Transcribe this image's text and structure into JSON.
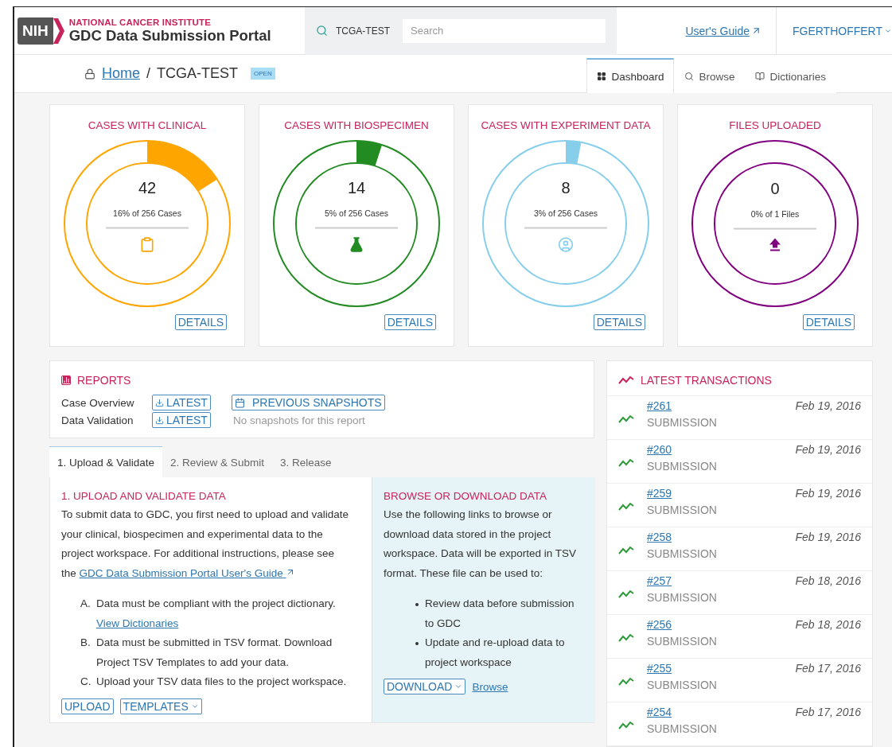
{
  "header": {
    "logo_mark": "NIH",
    "institute": "NATIONAL CANCER INSTITUTE",
    "portal_title": "GDC Data Submission Portal",
    "project": "TCGA-TEST",
    "search": {
      "placeholder": "Search"
    },
    "guide_link": "User's Guide",
    "user": "FGERTHOFFERT"
  },
  "breadcrumb": {
    "home": "Home",
    "separator": "/",
    "project": "TCGA-TEST",
    "badge": "OPEN"
  },
  "nav_tabs": [
    {
      "label": "Dashboard",
      "kind": "dashboard",
      "selected": true
    },
    {
      "label": "Browse",
      "kind": "browse",
      "selected": false
    },
    {
      "label": "Dictionaries",
      "kind": "dictionaries",
      "selected": false
    }
  ],
  "cards": [
    {
      "title": "CASES WITH CLINICAL",
      "kind": "clinical",
      "color": "#ffa500",
      "count": "42",
      "caption": "16% of 256 Cases",
      "level": 0.16,
      "button": "DETAILS"
    },
    {
      "title": "CASES WITH BIOSPECIMEN",
      "kind": "biospecimen",
      "color": "#228b22",
      "count": "14",
      "caption": "5% of 256 Cases",
      "level": 0.05,
      "button": "DETAILS"
    },
    {
      "title": "CASES WITH EXPERIMENT DATA",
      "kind": "experiment",
      "color": "#87ceeb",
      "count": "8",
      "caption": "3% of 256 Cases",
      "level": 0.03,
      "button": "DETAILS"
    },
    {
      "title": "FILES UPLOADED",
      "kind": "files",
      "color": "#800080",
      "count": "0",
      "caption": "0% of 1 Files",
      "level": 0,
      "button": "DETAILS"
    }
  ],
  "reports": {
    "title": "REPORTS",
    "rows": [
      {
        "label": "Case Overview",
        "button": "LATEST",
        "extra": {
          "kind": "button",
          "text": "PREVIOUS SNAPSHOTS"
        }
      },
      {
        "label": "Data Validation",
        "button": "LATEST",
        "extra": {
          "kind": "note",
          "text": "No snapshots for this report"
        }
      }
    ]
  },
  "step_tabs": [
    {
      "label": "1. Upload & Validate",
      "selected": true
    },
    {
      "label": "2. Review & Submit",
      "selected": false
    },
    {
      "label": "3. Release",
      "selected": false
    }
  ],
  "upload": {
    "title": "1. UPLOAD AND VALIDATE DATA",
    "intro": "To submit data to GDC, you first need to upload and validate your clinical, biospecimen and experimental data to the project workspace. For additional instructions, please see the",
    "intro_link": "GDC Data Submission Portal User's Guide",
    "steps": [
      {
        "marker": "A.",
        "text": "Data must be compliant with the project dictionary.",
        "link": "View Dictionaries"
      },
      {
        "marker": "B.",
        "text": "Data must be submitted in TSV format. Download Project TSV Templates to add your data."
      },
      {
        "marker": "C.",
        "text": "Upload your TSV data files to the project workspace."
      }
    ],
    "buttons": [
      {
        "label": "UPLOAD",
        "dropdown": false
      },
      {
        "label": "TEMPLATES",
        "dropdown": true
      }
    ]
  },
  "browse": {
    "title": "BROWSE OR DOWNLOAD DATA",
    "intro": "Use the following links to browse or download data stored in the project workspace. Data will be exported in TSV format. These file can be used to:",
    "bullets": [
      "Review data before submission to GDC",
      "Update and re-upload data to project workspace"
    ],
    "download": "DOWNLOAD",
    "link": "Browse"
  },
  "transactions": {
    "title": "LATEST TRANSACTIONS",
    "rows": [
      {
        "id": "#261",
        "type": "SUBMISSION",
        "date": "Feb 19, 2016"
      },
      {
        "id": "#260",
        "type": "SUBMISSION",
        "date": "Feb 19, 2016"
      },
      {
        "id": "#259",
        "type": "SUBMISSION",
        "date": "Feb 19, 2016"
      },
      {
        "id": "#258",
        "type": "SUBMISSION",
        "date": "Feb 19, 2016"
      },
      {
        "id": "#257",
        "type": "SUBMISSION",
        "date": "Feb 18, 2016"
      },
      {
        "id": "#256",
        "type": "SUBMISSION",
        "date": "Feb 18, 2016"
      },
      {
        "id": "#255",
        "type": "SUBMISSION",
        "date": "Feb 17, 2016"
      },
      {
        "id": "#254",
        "type": "SUBMISSION",
        "date": "Feb 17, 2016"
      }
    ]
  }
}
